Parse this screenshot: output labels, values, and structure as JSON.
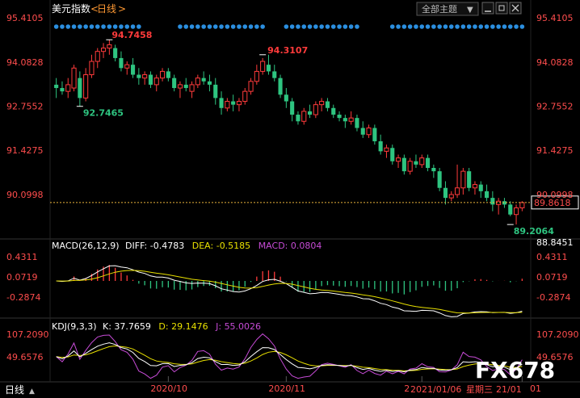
{
  "header": {
    "symbol": "美元指数",
    "period_open": "<",
    "period": "日线",
    "period_close": ">",
    "theme_button": "全部主题",
    "theme_arrow": "▼"
  },
  "colors": {
    "background": "#000000",
    "up": "#ff3b3b",
    "down": "#2ec480",
    "axis_text": "#ff4d4d",
    "grid": "#2a2a2a",
    "dashed_line": "#e9b23a",
    "diff_line": "#ffffff",
    "dea_line": "#e8e000",
    "macd_label": "#c64bd6",
    "kdj_k": "#ffffff",
    "kdj_d": "#e8e000",
    "kdj_j": "#c64bd6",
    "dot_color": "#2b8fe0"
  },
  "chart_data": [
    {
      "type": "candlestick",
      "title": "美元指数 日线",
      "y_ticks": [
        "95.4105",
        "94.0828",
        "92.7552",
        "91.4275",
        "90.0998"
      ],
      "ylim": [
        88.8451,
        95.4105
      ],
      "x_ticks": [
        "2020/10",
        "2020/11",
        "2020/12",
        "2021/01"
      ],
      "current_price": "89.8618",
      "annotations": {
        "high_1": "94.7458",
        "low_1": "92.7465",
        "high_2": "94.3107",
        "low_2": "89.2064"
      },
      "candles_ohlc": [
        [
          93.4,
          93.6,
          93.0,
          93.3
        ],
        [
          93.3,
          93.5,
          93.1,
          93.2
        ],
        [
          93.2,
          93.6,
          93.0,
          93.4
        ],
        [
          93.3,
          94.0,
          93.2,
          93.9
        ],
        [
          93.6,
          93.8,
          92.75,
          93.0
        ],
        [
          93.0,
          93.9,
          92.9,
          93.7
        ],
        [
          93.7,
          94.3,
          93.6,
          94.1
        ],
        [
          94.1,
          94.5,
          93.9,
          94.4
        ],
        [
          94.4,
          94.65,
          94.2,
          94.5
        ],
        [
          94.5,
          94.75,
          94.3,
          94.6
        ],
        [
          94.5,
          94.6,
          94.1,
          94.2
        ],
        [
          94.2,
          94.4,
          93.8,
          93.9
        ],
        [
          93.9,
          94.1,
          93.7,
          94.0
        ],
        [
          94.0,
          94.2,
          93.6,
          93.7
        ],
        [
          93.7,
          93.9,
          93.4,
          93.6
        ],
        [
          93.6,
          93.8,
          93.4,
          93.7
        ],
        [
          93.7,
          93.8,
          93.3,
          93.4
        ],
        [
          93.4,
          93.7,
          93.2,
          93.6
        ],
        [
          93.6,
          93.9,
          93.5,
          93.8
        ],
        [
          93.8,
          93.9,
          93.5,
          93.6
        ],
        [
          93.6,
          93.7,
          93.2,
          93.3
        ],
        [
          93.3,
          93.5,
          93.0,
          93.4
        ],
        [
          93.4,
          93.6,
          93.2,
          93.3
        ],
        [
          93.2,
          93.5,
          93.0,
          93.4
        ],
        [
          93.4,
          93.7,
          93.3,
          93.6
        ],
        [
          93.6,
          93.8,
          93.4,
          93.5
        ],
        [
          93.5,
          93.7,
          93.2,
          93.4
        ],
        [
          93.4,
          93.6,
          92.8,
          93.0
        ],
        [
          93.0,
          93.2,
          92.5,
          92.7
        ],
        [
          92.7,
          93.0,
          92.6,
          92.9
        ],
        [
          92.9,
          93.1,
          92.6,
          92.8
        ],
        [
          92.8,
          93.0,
          92.6,
          92.9
        ],
        [
          92.9,
          93.3,
          92.8,
          93.2
        ],
        [
          93.2,
          93.6,
          93.1,
          93.5
        ],
        [
          93.5,
          94.0,
          93.4,
          93.8
        ],
        [
          93.8,
          94.2,
          93.7,
          94.1
        ],
        [
          94.0,
          94.3,
          93.7,
          93.8
        ],
        [
          93.8,
          94.0,
          93.5,
          93.6
        ],
        [
          93.6,
          93.7,
          93.0,
          93.1
        ],
        [
          93.1,
          93.3,
          92.7,
          92.9
        ],
        [
          92.9,
          93.0,
          92.3,
          92.5
        ],
        [
          92.5,
          92.6,
          92.2,
          92.3
        ],
        [
          92.3,
          92.7,
          92.2,
          92.6
        ],
        [
          92.6,
          92.8,
          92.4,
          92.5
        ],
        [
          92.5,
          92.9,
          92.4,
          92.8
        ],
        [
          92.8,
          93.0,
          92.6,
          92.9
        ],
        [
          92.9,
          93.0,
          92.6,
          92.7
        ],
        [
          92.7,
          92.8,
          92.4,
          92.5
        ],
        [
          92.5,
          92.6,
          92.3,
          92.4
        ],
        [
          92.4,
          92.5,
          92.1,
          92.3
        ],
        [
          92.3,
          92.6,
          92.2,
          92.4
        ],
        [
          92.4,
          92.5,
          92.0,
          92.1
        ],
        [
          92.1,
          92.3,
          91.8,
          91.9
        ],
        [
          91.9,
          92.2,
          91.8,
          92.1
        ],
        [
          92.1,
          92.2,
          91.6,
          91.7
        ],
        [
          91.7,
          91.9,
          91.3,
          91.4
        ],
        [
          91.4,
          91.6,
          91.2,
          91.5
        ],
        [
          91.5,
          91.6,
          91.0,
          91.1
        ],
        [
          91.1,
          91.3,
          90.9,
          91.2
        ],
        [
          91.2,
          91.3,
          90.7,
          90.8
        ],
        [
          90.8,
          91.2,
          90.7,
          91.1
        ],
        [
          91.1,
          91.3,
          90.9,
          91.0
        ],
        [
          91.0,
          91.3,
          90.9,
          91.2
        ],
        [
          91.2,
          91.3,
          90.8,
          90.9
        ],
        [
          90.9,
          91.0,
          90.6,
          90.8
        ],
        [
          90.8,
          90.9,
          90.2,
          90.3
        ],
        [
          90.3,
          90.5,
          89.8,
          90.0
        ],
        [
          90.0,
          90.2,
          89.9,
          90.1
        ],
        [
          90.1,
          91.0,
          90.0,
          90.3
        ],
        [
          90.3,
          90.9,
          90.1,
          90.8
        ],
        [
          90.8,
          90.9,
          90.2,
          90.3
        ],
        [
          90.3,
          90.5,
          90.1,
          90.4
        ],
        [
          90.4,
          90.5,
          90.0,
          90.2
        ],
        [
          90.2,
          90.4,
          89.9,
          90.0
        ],
        [
          90.0,
          90.2,
          89.6,
          89.8
        ],
        [
          89.8,
          90.0,
          89.5,
          89.9
        ],
        [
          89.9,
          90.0,
          89.7,
          89.8
        ],
        [
          89.8,
          89.9,
          89.45,
          89.5
        ],
        [
          89.5,
          89.8,
          89.2,
          89.7
        ],
        [
          89.7,
          89.9,
          89.6,
          89.86
        ]
      ]
    },
    {
      "type": "macd",
      "title": "MACD(26,12,9)",
      "diff_label": "DIFF:",
      "diff": "-0.4783",
      "dea_label": "DEA:",
      "dea": "-0.5185",
      "macd_label": "MACD:",
      "macd": "0.0804",
      "y_ticks": [
        "88.8451",
        "0.4311",
        "0.0719",
        "-0.2874"
      ],
      "ylim": [
        -0.65,
        0.55
      ]
    },
    {
      "type": "kdj",
      "title": "KDJ(9,3,3)",
      "k_label": "K:",
      "k": "37.7659",
      "d_label": "D:",
      "d": "29.1476",
      "j_label": "J:",
      "j": "55.0026",
      "y_ticks": [
        "107.2090",
        "49.6576"
      ],
      "ylim": [
        -5,
        115
      ]
    }
  ],
  "footer": {
    "period_label": "日线",
    "arrow_up": "▲",
    "date": "2021/01/06",
    "weekday": "星期三",
    "date_suffix": "21/01"
  },
  "watermark": "FX678"
}
